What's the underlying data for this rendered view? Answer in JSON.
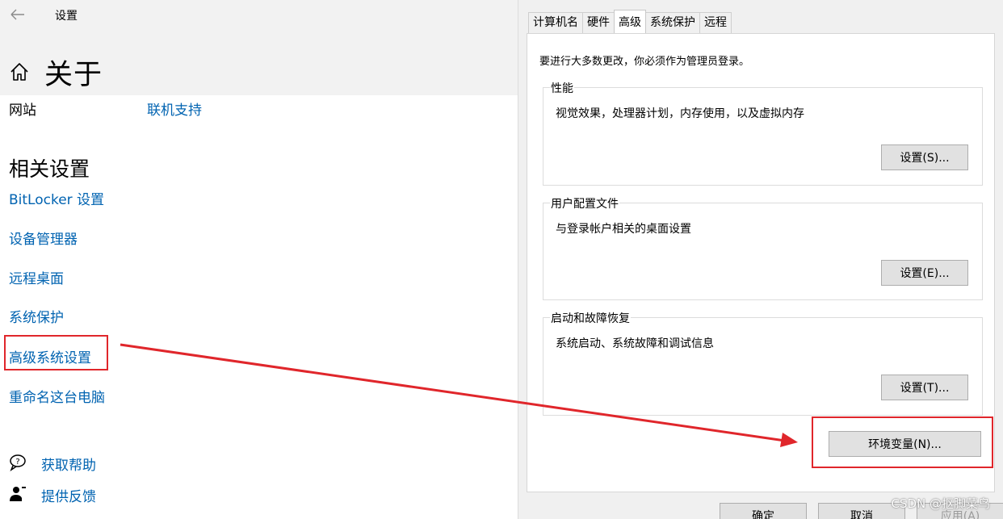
{
  "settings": {
    "app_title": "设置",
    "page_title": "关于",
    "website_label": "网站",
    "online_support_link": "联机支持",
    "related_section_title": "相关设置",
    "links": [
      {
        "label": "BitLocker 设置"
      },
      {
        "label": "设备管理器"
      },
      {
        "label": "远程桌面"
      },
      {
        "label": "系统保护"
      },
      {
        "label": "高级系统设置"
      },
      {
        "label": "重命名这台电脑"
      }
    ],
    "get_help": "获取帮助",
    "give_feedback": "提供反馈",
    "link_color": "#0063b1"
  },
  "dialog": {
    "tabs": [
      {
        "label": "计算机名"
      },
      {
        "label": "硬件"
      },
      {
        "label": "高级",
        "active": true
      },
      {
        "label": "系统保护"
      },
      {
        "label": "远程"
      }
    ],
    "notice": "要进行大多数更改，你必须作为管理员登录。",
    "groups": [
      {
        "title": "性能",
        "description": "视觉效果，处理器计划，内存使用，以及虚拟内存",
        "button": "设置(S)..."
      },
      {
        "title": "用户配置文件",
        "description": "与登录帐户相关的桌面设置",
        "button": "设置(E)..."
      },
      {
        "title": "启动和故障恢复",
        "description": "系统启动、系统故障和调试信息",
        "button": "设置(T)..."
      }
    ],
    "env_button": "环境变量(N)...",
    "ok_button": "确定",
    "cancel_button": "取消",
    "apply_button": "应用(A)"
  },
  "annotation": {
    "color": "#e0262b"
  },
  "watermark": "CSDN @抠脚菜鸟"
}
